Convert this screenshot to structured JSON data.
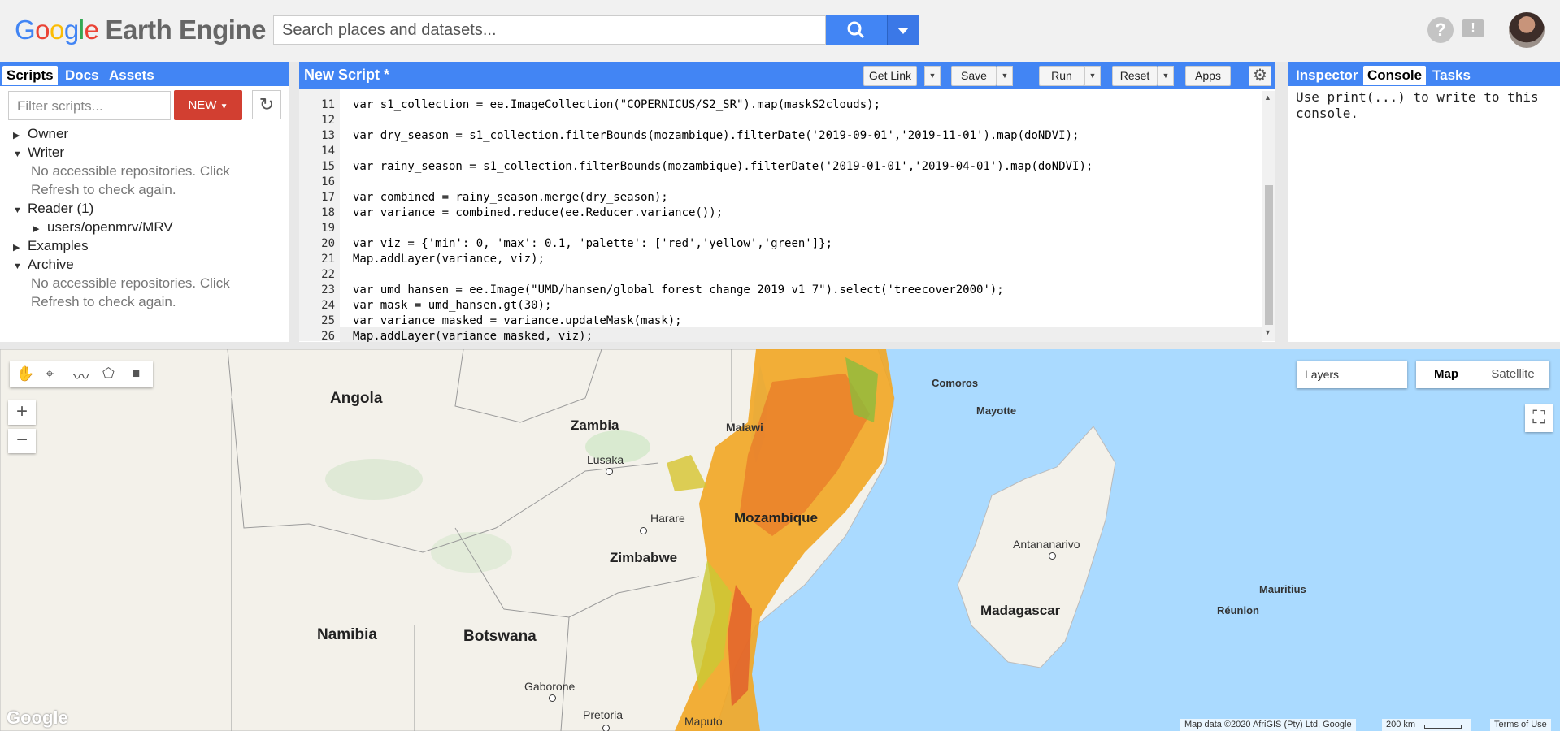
{
  "header": {
    "logo_google": [
      "G",
      "o",
      "o",
      "g",
      "l",
      "e"
    ],
    "logo_suffix": "Earth Engine",
    "search_placeholder": "Search places and datasets...",
    "help_icon": "?",
    "feedback_icon": "!"
  },
  "left_panel": {
    "tabs": [
      "Scripts",
      "Docs",
      "Assets"
    ],
    "filter_placeholder": "Filter scripts...",
    "new_label": "NEW",
    "tree": [
      {
        "label": "Owner",
        "expanded": false
      },
      {
        "label": "Writer",
        "expanded": true,
        "note": "No accessible repositories. Click Refresh to check again."
      },
      {
        "label": "Reader  (1)",
        "expanded": true,
        "child": "users/openmrv/MRV"
      },
      {
        "label": "Examples",
        "expanded": false
      },
      {
        "label": "Archive",
        "expanded": true,
        "note": "No accessible repositories. Click Refresh to check again."
      }
    ],
    "note_line1": "No accessible repositories. Click",
    "note_line2": "Refresh to check again."
  },
  "editor": {
    "title": "New Script *",
    "buttons": {
      "get_link": "Get Link",
      "save": "Save",
      "run": "Run",
      "reset": "Reset",
      "apps": "Apps"
    },
    "lines": [
      {
        "n": "11",
        "code": "var s1_collection = ee.ImageCollection(\"COPERNICUS/S2_SR\").map(maskS2clouds);"
      },
      {
        "n": "12",
        "code": ""
      },
      {
        "n": "13",
        "code": "var dry_season = s1_collection.filterBounds(mozambique).filterDate('2019-09-01','2019-11-01').map(doNDVI);"
      },
      {
        "n": "14",
        "code": ""
      },
      {
        "n": "15",
        "code": "var rainy_season = s1_collection.filterBounds(mozambique).filterDate('2019-01-01','2019-04-01').map(doNDVI);"
      },
      {
        "n": "16",
        "code": ""
      },
      {
        "n": "17",
        "code": "var combined = rainy_season.merge(dry_season);"
      },
      {
        "n": "18",
        "code": "var variance = combined.reduce(ee.Reducer.variance());"
      },
      {
        "n": "19",
        "code": ""
      },
      {
        "n": "20",
        "code": "var viz = {'min': 0, 'max': 0.1, 'palette': ['red','yellow','green']};"
      },
      {
        "n": "21",
        "code": "Map.addLayer(variance, viz);"
      },
      {
        "n": "22",
        "code": ""
      },
      {
        "n": "23",
        "code": "var umd_hansen = ee.Image(\"UMD/hansen/global_forest_change_2019_v1_7\").select('treecover2000');"
      },
      {
        "n": "24",
        "code": "var mask = umd_hansen.gt(30);"
      },
      {
        "n": "25",
        "code": "var variance_masked = variance.updateMask(mask);"
      },
      {
        "n": "26",
        "code": "Map.addLayer(variance_masked, viz);"
      }
    ]
  },
  "right_panel": {
    "tabs": [
      "Inspector",
      "Console",
      "Tasks"
    ],
    "console_text": "Use print(...) to write to this console."
  },
  "map": {
    "layers_label": "Layers",
    "type_buttons": [
      "Map",
      "Satellite"
    ],
    "zoom_in": "+",
    "zoom_out": "−",
    "labels": {
      "angola": "Angola",
      "zambia": "Zambia",
      "lusaka": "Lusaka",
      "malawi": "Malawi",
      "harare": "Harare",
      "mozambique": "Mozambique",
      "zimbabwe": "Zimbabwe",
      "namibia": "Namibia",
      "botswana": "Botswana",
      "gaborone": "Gaborone",
      "pretoria": "Pretoria",
      "maputo": "Maputo",
      "comoros": "Comoros",
      "mayotte": "Mayotte",
      "antananarivo": "Antananarivo",
      "madagascar": "Madagascar",
      "mauritius": "Mauritius",
      "reunion": "Réunion"
    },
    "attribution": "Map data ©2020 AfriGIS (Pty) Ltd, Google",
    "scale": "200 km",
    "terms": "Terms of Use",
    "google_logo": "Google"
  }
}
